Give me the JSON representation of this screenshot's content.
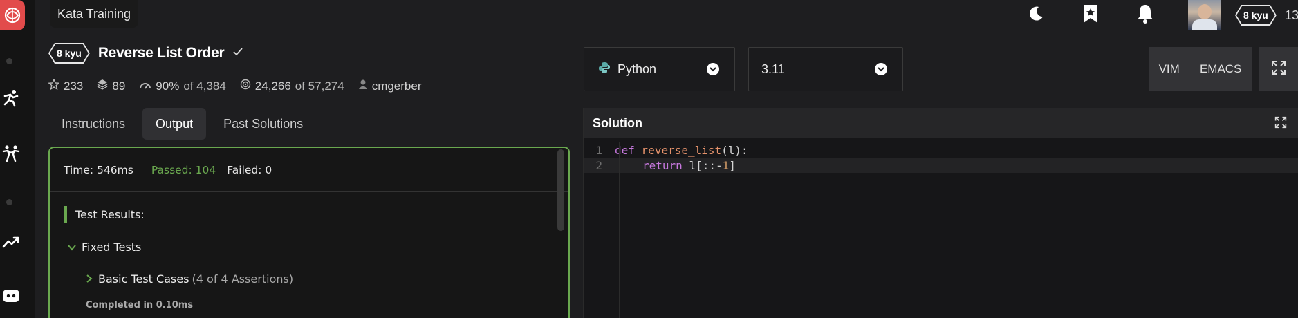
{
  "topbar": {
    "kata_training_label": "Kata Training",
    "rank_label": "8 kyu",
    "honor_partial": "13"
  },
  "kata": {
    "rank": "8 kyu",
    "title": "Reverse List Order",
    "stats": {
      "stars": "233",
      "collections": "89",
      "satisfaction": "90%",
      "satisfaction_of": "of 4,384",
      "completed": "24,266",
      "completed_of": "of 57,274",
      "author": "cmgerber"
    }
  },
  "tabs": [
    {
      "label": "Instructions",
      "active": false
    },
    {
      "label": "Output",
      "active": true
    },
    {
      "label": "Past Solutions",
      "active": false
    }
  ],
  "output": {
    "time": "Time: 546ms",
    "passed": "Passed: 104",
    "failed": "Failed: 0",
    "results_heading": "Test Results:",
    "fixed_tests": "Fixed Tests",
    "basic_cases": "Basic Test Cases",
    "assertions": "(4 of 4 Assertions)",
    "completed": "Completed in 0.10ms"
  },
  "editor": {
    "language": "Python",
    "version": "3.11",
    "modes": [
      "VIM",
      "EMACS"
    ],
    "solution_label": "Solution",
    "lines": [
      {
        "number": "1"
      },
      {
        "number": "2"
      }
    ],
    "code": {
      "l1_def": "def",
      "l1_name": "reverse_list",
      "l1_args": "(l):",
      "l2_return": "return",
      "l2_expr_a": "l[::-",
      "l2_num": "1",
      "l2_expr_b": "]"
    }
  },
  "colors": {
    "accent_green": "#6aa84f",
    "logo_red": "#e24b4b",
    "background": "#1e1e20"
  }
}
